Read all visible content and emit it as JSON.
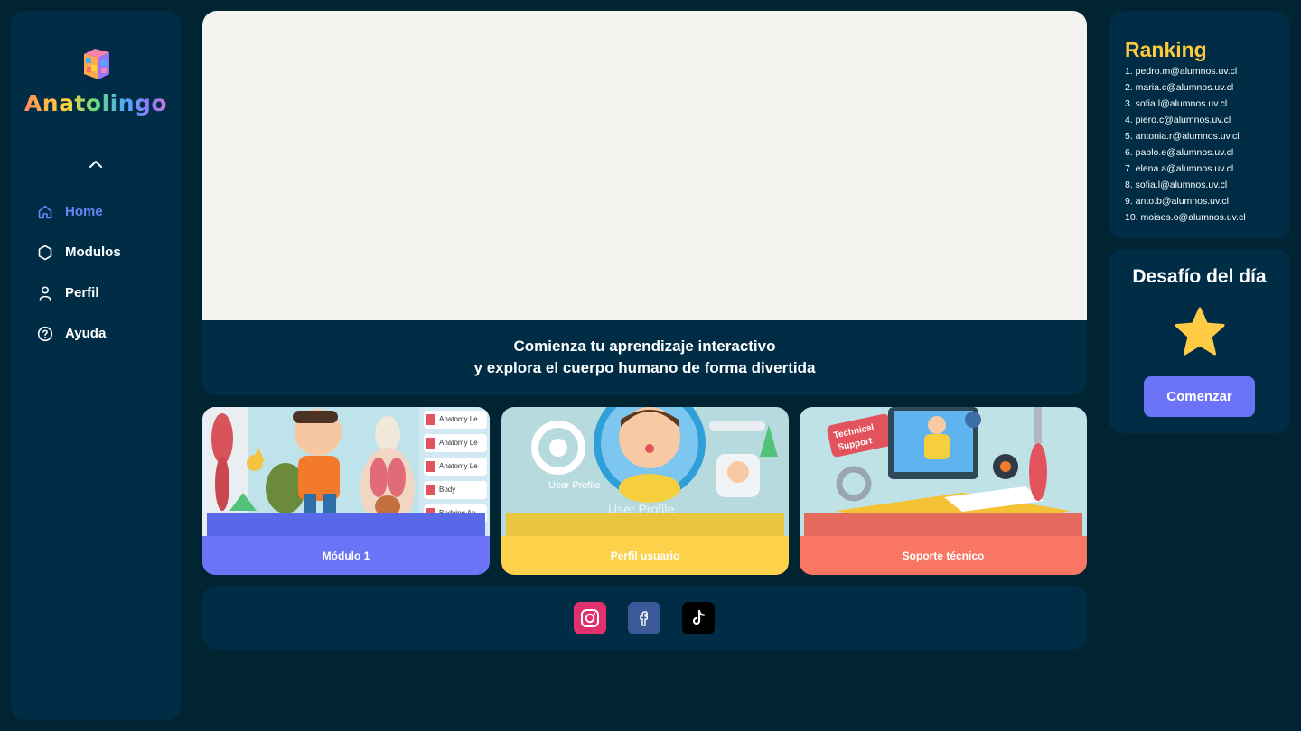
{
  "app": {
    "name": "Anatolingo"
  },
  "nav": [
    {
      "label": "Home",
      "icon": "home-icon",
      "active": true
    },
    {
      "label": "Modulos",
      "icon": "hexagon-icon",
      "active": false
    },
    {
      "label": "Perfil",
      "icon": "user-icon",
      "active": false
    },
    {
      "label": "Ayuda",
      "icon": "help-icon",
      "active": false
    }
  ],
  "hero": {
    "line1": "Comienza tu aprendizaje interactivo",
    "line2": "y explora el cuerpo humano de forma divertida"
  },
  "cards": [
    {
      "label": "Módulo 1",
      "color": "#6b74f6",
      "image_text": [
        "Anatomy Le",
        "Anatomy Le",
        "Anatomy Le",
        "Body",
        "Bodying An"
      ]
    },
    {
      "label": "Perfil usuario",
      "color": "#fdd24a",
      "image_text": [
        "User Profile",
        "User Profile"
      ]
    },
    {
      "label": "Soporte técnico",
      "color": "#f87663",
      "image_text": [
        "Technical",
        "Support"
      ]
    }
  ],
  "social": [
    {
      "name": "instagram-icon",
      "color": "#e1306c"
    },
    {
      "name": "facebook-icon",
      "color": "#3b5998"
    },
    {
      "name": "tiktok-icon",
      "color": "#000000"
    }
  ],
  "ranking": {
    "title": "Ranking",
    "entries": [
      "1. pedro.m@alumnos.uv.cl",
      "2. maria.c@alumnos.uv.cl",
      "3. sofia.l@alumnos.uv.cl",
      "4. piero.c@alumnos.uv.cl",
      "5. antonia.r@alumnos.uv.cl",
      "6. pablo.e@alumnos.uv.cl",
      "7. elena.a@alumnos.uv.cl",
      "8. sofia.l@alumnos.uv.cl",
      "9. anto.b@alumnos.uv.cl",
      "10. moises.o@alumnos.uv.cl"
    ]
  },
  "challenge": {
    "title": "Desafío del día",
    "button": "Comenzar"
  },
  "colors": {
    "background": "#012432",
    "panel": "#002d45",
    "accent": "#6b74f6",
    "ranking_title": "#ffc93f",
    "active_nav": "#6b83f5"
  }
}
